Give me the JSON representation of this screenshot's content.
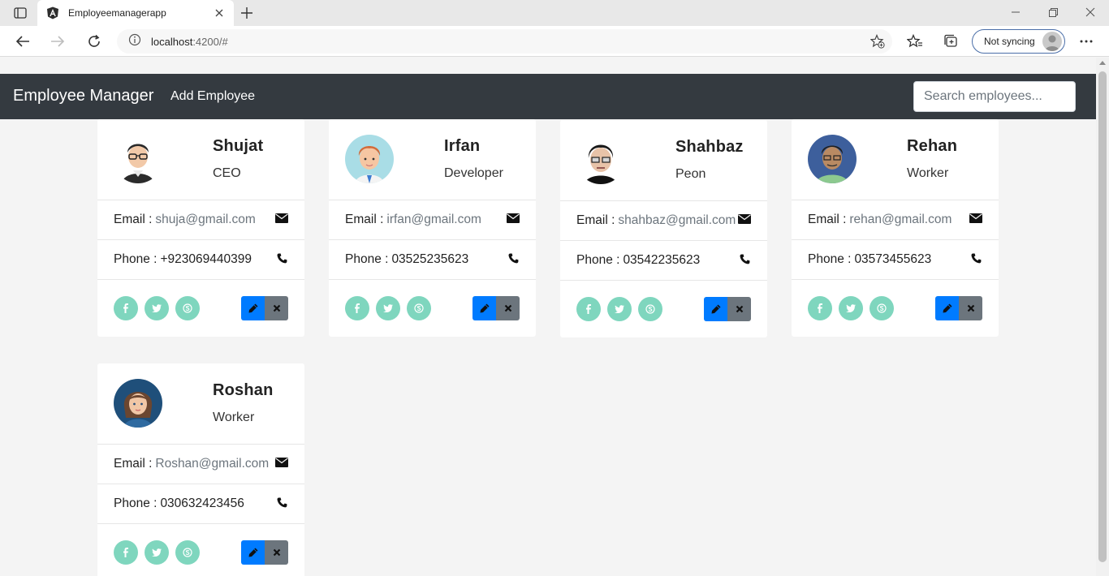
{
  "browser": {
    "tab_title": "Employeemanagerapp",
    "url_host": "localhost",
    "url_rest": ":4200/#",
    "sync_label": "Not syncing"
  },
  "app": {
    "brand": "Employee Manager",
    "nav_link": "Add Employee",
    "search_placeholder": "Search employees..."
  },
  "labels": {
    "email_prefix": "Email :",
    "phone_prefix": "Phone :"
  },
  "social_icons": [
    "facebook-icon",
    "twitter-icon",
    "skype-icon"
  ],
  "colors": {
    "navbar": "#343a40",
    "edit_button": "#007bff",
    "delete_button": "#6c757d",
    "social": "#7fd6be"
  },
  "employees": [
    {
      "name": "Shujat",
      "job_title": "CEO",
      "email": "shuja@gmail.com",
      "phone": "+923069440399",
      "avatar": "man-with-glasses-avatar"
    },
    {
      "name": "Irfan",
      "job_title": "Developer",
      "email": "irfan@gmail.com",
      "phone": "03525235623",
      "avatar": "red-haired-man-avatar"
    },
    {
      "name": "Shahbaz",
      "job_title": "Peon",
      "email": "shahbaz@gmail.com",
      "phone": "03542235623",
      "avatar": "man-dark-hair-avatar"
    },
    {
      "name": "Rehan",
      "job_title": "Worker",
      "email": "rehan@gmail.com",
      "phone": "03573455623",
      "avatar": "man-green-shirt-avatar"
    },
    {
      "name": "Roshan",
      "job_title": "Worker",
      "email": "Roshan@gmail.com",
      "phone": "030632423456",
      "avatar": "woman-avatar"
    }
  ]
}
